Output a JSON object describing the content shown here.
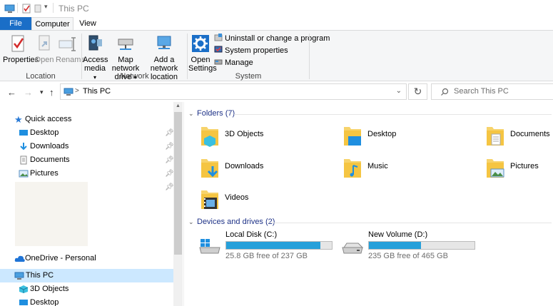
{
  "window": {
    "title": "This PC"
  },
  "ribbon": {
    "tabs": [
      {
        "label": "File"
      },
      {
        "label": "Computer"
      },
      {
        "label": "View"
      }
    ],
    "groups": {
      "location": "Location",
      "network": "Network",
      "system": "System"
    },
    "buttons": {
      "properties": "Properties",
      "open": "Open",
      "rename": "Rename",
      "access_media_1": "Access",
      "access_media_2": "media",
      "map_drive_1": "Map network",
      "map_drive_2": "drive",
      "add_location_1": "Add a network",
      "add_location_2": "location",
      "open_settings_1": "Open",
      "open_settings_2": "Settings",
      "uninstall": "Uninstall or change a program",
      "system_properties": "System properties",
      "manage": "Manage"
    }
  },
  "navbar": {
    "address": "This PC",
    "search_placeholder": "Search This PC"
  },
  "sidebar": {
    "quick_access": "Quick access",
    "items": [
      {
        "label": "Desktop"
      },
      {
        "label": "Downloads"
      },
      {
        "label": "Documents"
      },
      {
        "label": "Pictures"
      }
    ],
    "onedrive": "OneDrive - Personal",
    "this_pc": "This PC",
    "pc_items": [
      {
        "label": "3D Objects"
      },
      {
        "label": "Desktop"
      }
    ]
  },
  "content": {
    "folders_header": "Folders (7)",
    "folders": [
      {
        "label": "3D Objects"
      },
      {
        "label": "Desktop"
      },
      {
        "label": "Documents"
      },
      {
        "label": "Downloads"
      },
      {
        "label": "Music"
      },
      {
        "label": "Pictures"
      },
      {
        "label": "Videos"
      }
    ],
    "drives_header": "Devices and drives (2)",
    "drives": [
      {
        "label": "Local Disk (C:)",
        "free": "25.8 GB free of 237 GB",
        "used_fraction": 0.891
      },
      {
        "label": "New Volume (D:)",
        "free": "235 GB free of 465 GB",
        "used_fraction": 0.495
      }
    ]
  },
  "colors": {
    "accent": "#1a6ec7",
    "drive_bar": "#26a0da",
    "folder": "#f5c542",
    "selected": "#cce8ff"
  }
}
